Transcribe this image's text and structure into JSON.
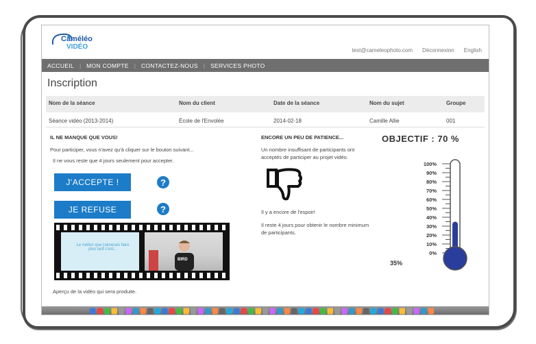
{
  "logo": {
    "line1": "Caméléo",
    "line2": "VIDÉO"
  },
  "top_links": {
    "email": "test@cameleophoto.com",
    "logout": "Déconnexion",
    "language": "English"
  },
  "nav": [
    "ACCUEIL",
    "MON COMPTE",
    "CONTACTEZ-NOUS",
    "SERVICES PHOTO"
  ],
  "page_title": "Inscription",
  "table": {
    "headers": [
      "Nom de la séance",
      "Nom du client",
      "Date de la séance",
      "Nom du sujet",
      "Groupe"
    ],
    "row": [
      "Séance vidéo (2013-2014)",
      "École de l'Envolée",
      "2014-02-18",
      "Camille Allie",
      "001"
    ]
  },
  "left": {
    "title": "IL NE MANQUE QUE VOUS!",
    "line1": "Pour participer, vous n'avez qu'à cliquer sur le bouton suivant...",
    "line2": "Il ne vous reste que 4 jours seulement pour accepter.",
    "accept_label": "J'ACCEPTE !",
    "refuse_label": "JE REFUSE",
    "help_icon": "?",
    "film_text": "Le métier que j'aimerais faire\nplus tard c'est...",
    "shirt_text": "BIRD",
    "preview_caption": "Aperçu de la vidéo qui sera produite."
  },
  "middle": {
    "title": "ENCORE UN PEU DE PATIENCE...",
    "line1": "Un nombre insuffisant de participants ont",
    "line2": "acceptés de participer au projet vidéo.",
    "hope": "Il y a encore de l'espoir!",
    "remaining1": "Il reste 4 jours pour obtenir le nombre minimum",
    "remaining2": "de participants."
  },
  "right": {
    "objective": "OBJECTIF : 70 %",
    "current": "35%",
    "current_value": 35,
    "scale": [
      "100%",
      "90%",
      "80%",
      "70%",
      "60%",
      "50%",
      "40%",
      "30%",
      "20%",
      "10%",
      "0%"
    ],
    "fill_color": "#2b3d9c"
  },
  "colors": {
    "accent": "#1c7cc8",
    "nav": "#6f6f6f"
  }
}
